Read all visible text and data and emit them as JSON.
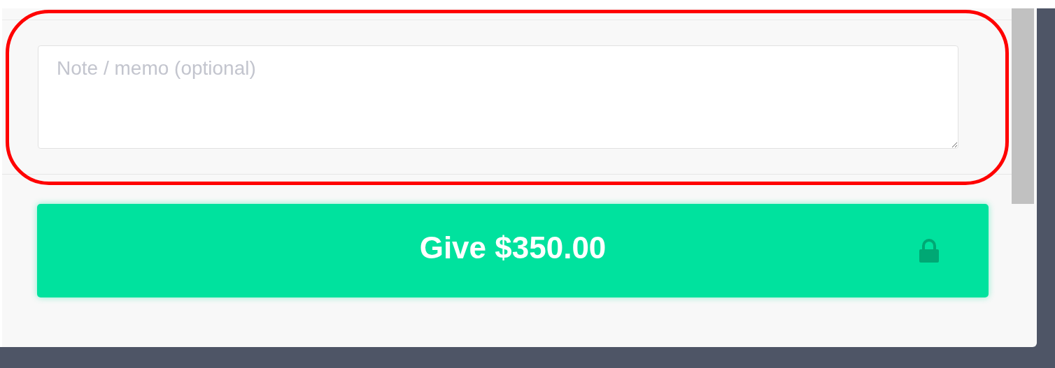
{
  "note_field": {
    "placeholder": "Note / memo (optional)"
  },
  "give_button": {
    "label": "Give $350.00"
  }
}
